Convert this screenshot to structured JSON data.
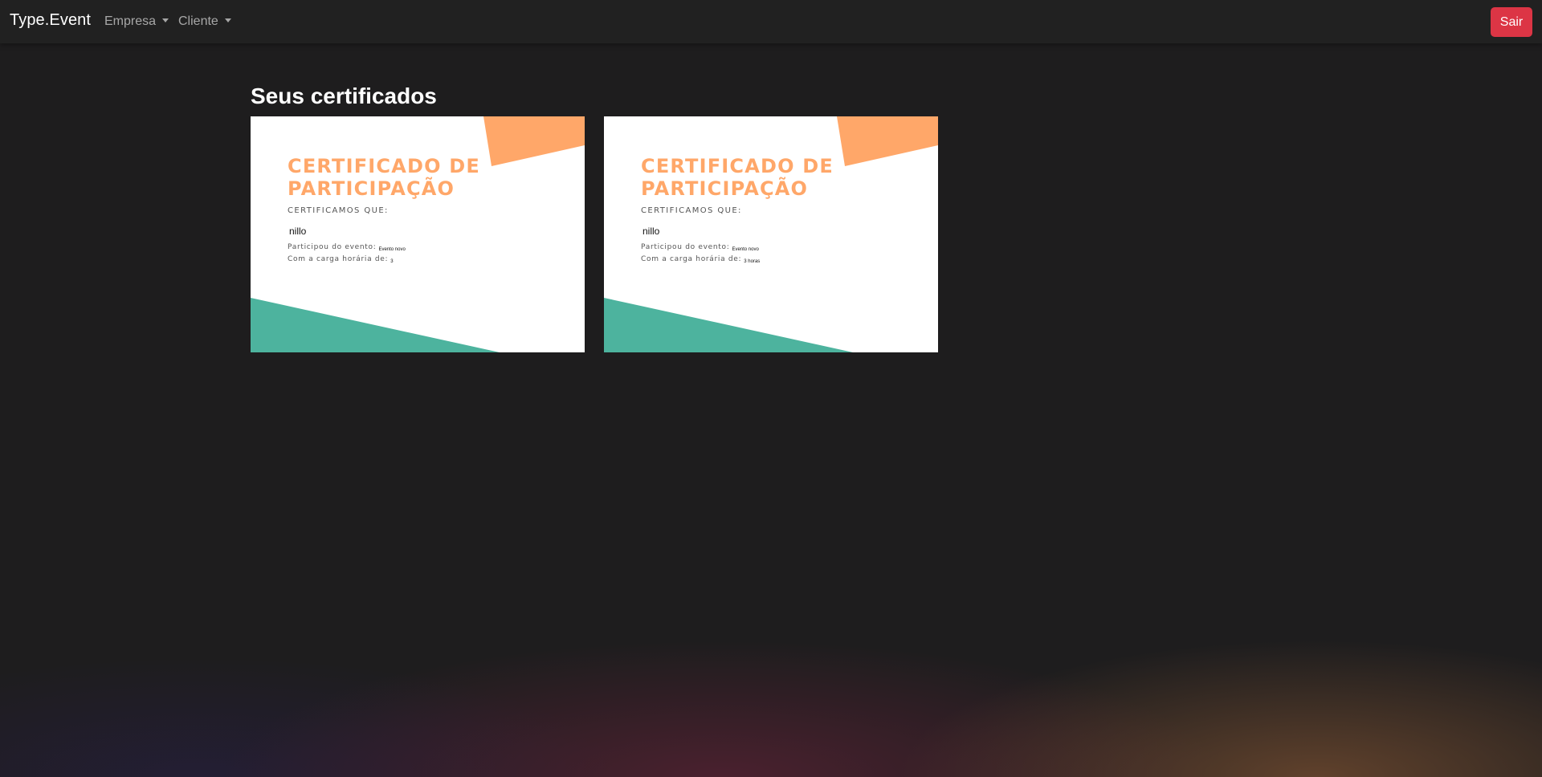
{
  "navbar": {
    "brand": "Type.Event",
    "menus": [
      {
        "label": "Empresa"
      },
      {
        "label": "Cliente"
      }
    ],
    "logout_label": "Sair"
  },
  "main": {
    "title": "Seus certificados",
    "certificates": [
      {
        "heading": "CERTIFICADO DE\nPARTICIPAÇÃO",
        "intro": "CERTIFICAMOS QUE:",
        "name": "nillo",
        "event_label": "Participou do evento:",
        "event_value": "Evento novo",
        "hours_label": "Com a carga horária de:",
        "hours_value": "3"
      },
      {
        "heading": "CERTIFICADO DE\nPARTICIPAÇÃO",
        "intro": "CERTIFICAMOS QUE:",
        "name": "nillo",
        "event_label": "Participou do evento:",
        "event_value": "Evento novo",
        "hours_label": "Com a carga horária de:",
        "hours_value": "3 horas"
      }
    ]
  },
  "colors": {
    "navbar_bg": "#212121",
    "page_bg": "#1e1d1e",
    "danger": "#dc3545",
    "cert_orange": "#ffa769",
    "cert_teal": "#4db39e"
  }
}
